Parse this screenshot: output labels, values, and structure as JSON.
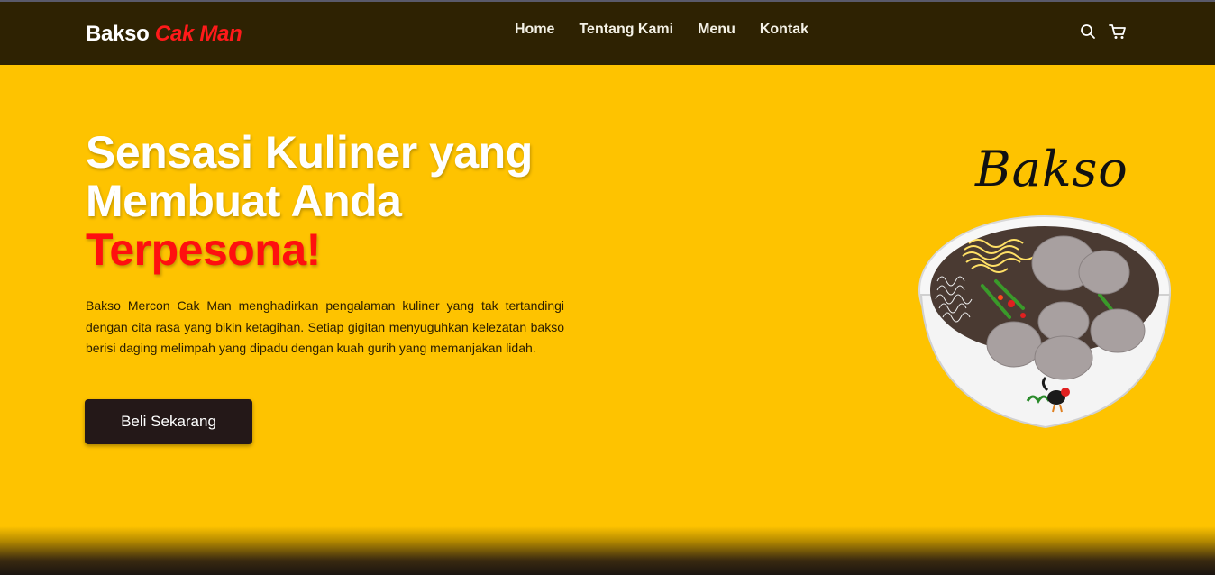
{
  "brand": {
    "name": "Bakso",
    "accent": "Cak Man"
  },
  "nav": {
    "links": [
      "Home",
      "Tentang Kami",
      "Menu",
      "Kontak"
    ],
    "icons": [
      "search-icon",
      "cart-icon"
    ]
  },
  "hero": {
    "title_line1": "Sensasi Kuliner yang",
    "title_line2": "Membuat Anda",
    "title_highlight": "Terpesona!",
    "description": "Bakso Mercon Cak Man menghadirkan pengalaman kuliner yang tak tertandingi dengan cita rasa yang bikin ketagihan. Setiap gigitan menyuguhkan kelezatan bakso berisi daging melimpah yang dipadu dengan kuah gurih yang memanjakan lidah.",
    "cta_label": "Beli Sekarang",
    "image_label": "Bakso"
  },
  "colors": {
    "background": "#fec300",
    "navbar": "#2e2202",
    "accent_red": "#ff0f0f",
    "button": "#241818"
  }
}
